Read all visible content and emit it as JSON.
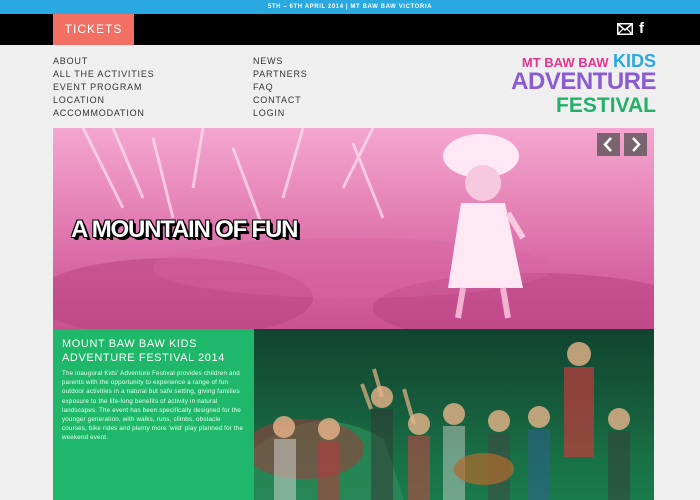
{
  "topbar": {
    "text": "5TH – 6TH APRIL 2014 | MT BAW BAW VICTORIA"
  },
  "navbar": {
    "tickets_label": "TICKETS",
    "icons": [
      "mail-icon",
      "facebook-icon"
    ]
  },
  "menu_left": [
    "ABOUT",
    "ALL THE ACTIVITIES",
    "EVENT PROGRAM",
    "LOCATION",
    "ACCOMMODATION"
  ],
  "menu_right": [
    "NEWS",
    "PARTNERS",
    "FAQ",
    "CONTACT",
    "LOGIN"
  ],
  "logo": {
    "line1_a": "MT BAW BAW",
    "line1_b": "KIDS",
    "line2": "ADVENTURE",
    "line3": "FESTIVAL"
  },
  "hero": {
    "title": "A MOUNTAIN OF FUN"
  },
  "panel": {
    "title": "MOUNT BAW BAW KIDS ADVENTURE FESTIVAL 2014",
    "body": "The inaugural Kids' Adventure Festival provides children and parents with the opportunity to experience a range of fun outdoor activities in a natural but safe setting, giving families exposure to the life-long benefits of activity in natural landscapes. The event has been specifically designed for the younger generation, with walks, runs, climbs, obstacle courses, bike rides and plenty more 'wild' play planned for the weekend event."
  },
  "colors": {
    "topbar": "#2aa8e0",
    "tickets": "#f26f63",
    "green": "#1fb86a",
    "pink": "#e977b3",
    "logo_purple": "#8a5bd1"
  }
}
